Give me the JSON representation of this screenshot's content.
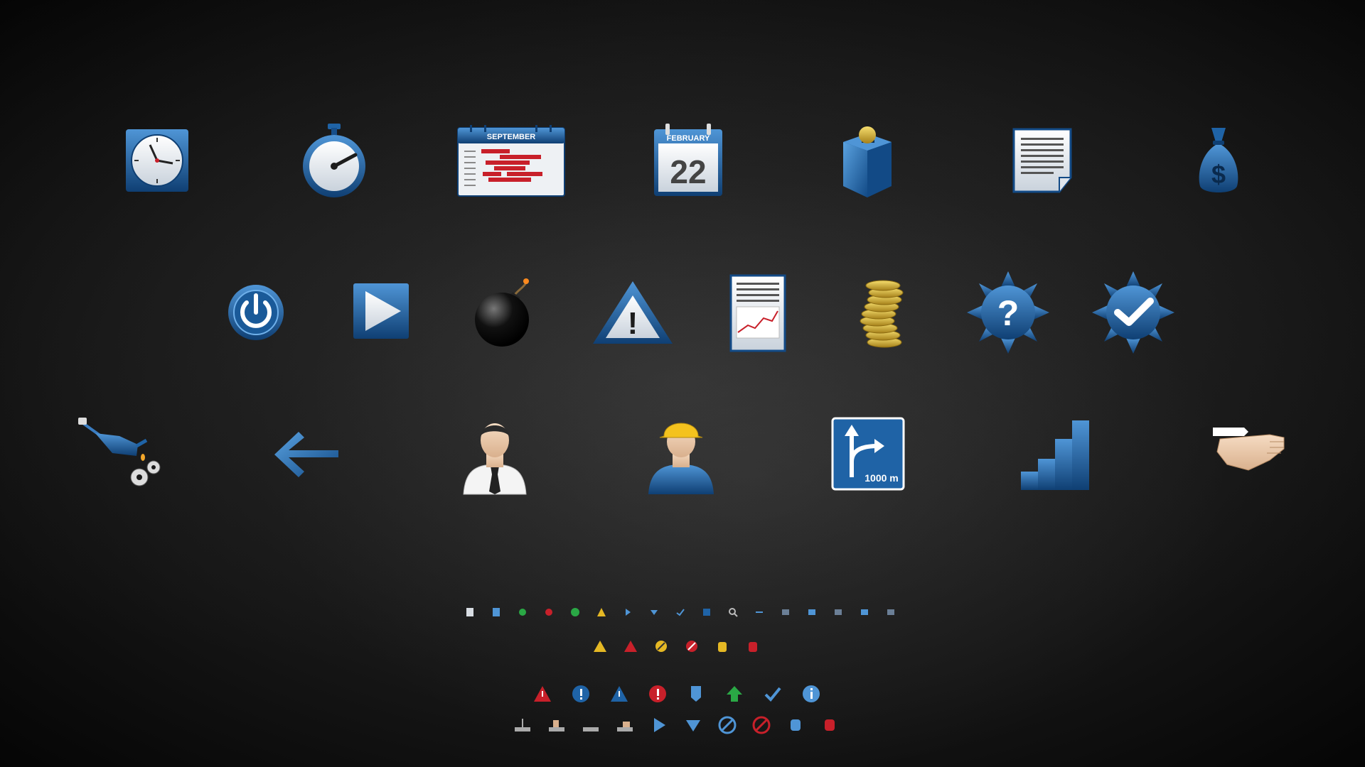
{
  "colors": {
    "blue": "#1f63a6",
    "blue_light": "#4f95d6",
    "blue_dark": "#0f3f73",
    "red": "#c8202a",
    "yellow": "#e5b824",
    "green": "#2aa845"
  },
  "row1": [
    {
      "icon": "clock-icon"
    },
    {
      "icon": "stopwatch-icon"
    },
    {
      "icon": "gantt-calendar-icon",
      "month": "SEPTEMBER"
    },
    {
      "icon": "calendar-day-icon",
      "month": "FEBRUARY",
      "day": "22"
    },
    {
      "icon": "coin-box-icon"
    },
    {
      "icon": "document-icon"
    },
    {
      "icon": "money-bag-icon",
      "symbol": "$"
    }
  ],
  "row2": [
    {
      "icon": "power-icon"
    },
    {
      "icon": "play-icon"
    },
    {
      "icon": "bomb-icon"
    },
    {
      "icon": "warning-icon",
      "symbol": "!"
    },
    {
      "icon": "report-chart-icon"
    },
    {
      "icon": "coin-stack-icon"
    },
    {
      "icon": "help-gear-icon",
      "symbol": "?"
    },
    {
      "icon": "check-gear-icon"
    }
  ],
  "row3": [
    {
      "icon": "oil-can-gears-icon"
    },
    {
      "icon": "back-arrow-icon"
    },
    {
      "icon": "businessman-icon"
    },
    {
      "icon": "worker-icon"
    },
    {
      "icon": "road-sign-icon",
      "label": "1000 m"
    },
    {
      "icon": "signal-bars-icon"
    },
    {
      "icon": "handshake-icon"
    }
  ],
  "tiny_row": [
    "doc",
    "doc-blue",
    "dot-green",
    "dot-red",
    "dot-green",
    "triangle-yellow",
    "arrow-right",
    "arrow-down",
    "check",
    "info",
    "search",
    "arrow-right-small",
    "list",
    "list-b",
    "list-c",
    "list-d",
    "list-e"
  ],
  "small_row1": [
    "warning-yellow",
    "warning-red",
    "prohibit-yellow",
    "prohibit-red",
    "hand-yellow",
    "hand-red"
  ],
  "small_row2": [
    "warning-red-icon",
    "info-blue-icon",
    "warning-blue-icon",
    "alert-red-icon",
    "shield-blue-icon",
    "up-arrow-green-icon",
    "check-blue-icon",
    "info-circle-blue-icon"
  ],
  "small_row3": [
    "tool-grey-icon",
    "tool-hand-icon",
    "tool-flat-icon",
    "tool-hand2-icon",
    "play-blue-icon",
    "down-blue-icon",
    "prohibit-blue-icon",
    "prohibit-red-icon",
    "hand-blue-icon",
    "hand-red-icon"
  ]
}
